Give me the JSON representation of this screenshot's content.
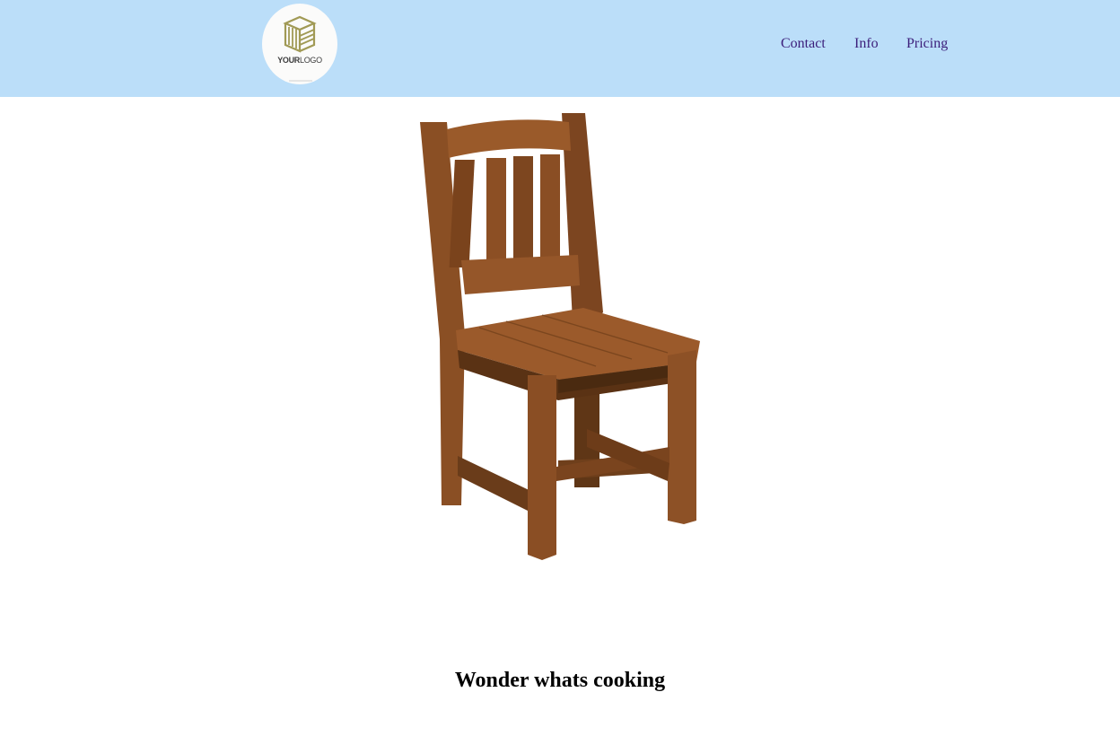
{
  "header": {
    "logo": {
      "brand_primary": "YOUR",
      "brand_secondary": "LOGO",
      "icon": "striped-cube-logo-icon"
    },
    "nav": [
      {
        "label": "Contact"
      },
      {
        "label": "Info"
      },
      {
        "label": "Pricing"
      }
    ]
  },
  "main": {
    "image": {
      "alt": "wooden chair",
      "icon": "wooden-chair-image"
    },
    "caption": "Wonder whats cooking"
  },
  "colors": {
    "header_bg": "#bbdef9",
    "nav_link": "#3b1d7a",
    "wood_mid": "#8a4f24",
    "wood_dark": "#5a3214",
    "logo_gold": "#a19a55"
  }
}
